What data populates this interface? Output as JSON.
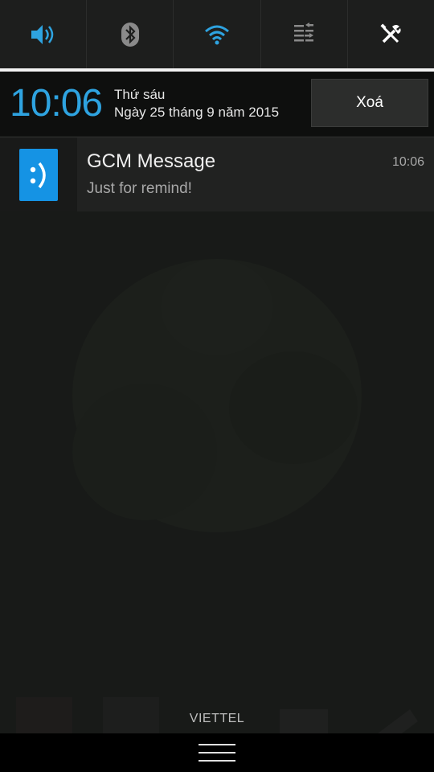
{
  "quick_settings": {
    "tiles": [
      {
        "icon": "volume-icon",
        "color": "#2ea3e0"
      },
      {
        "icon": "bluetooth-icon",
        "color": "#8a8a8a"
      },
      {
        "icon": "wifi-icon",
        "color": "#2ea3e0"
      },
      {
        "icon": "data-sync-icon",
        "color": "#8a8a8a"
      },
      {
        "icon": "settings-tools-icon",
        "color": "#ffffff"
      }
    ]
  },
  "header": {
    "clock": "10:06",
    "weekday": "Thứ sáu",
    "date": "Ngày 25 tháng 9 năm 2015",
    "clear_label": "Xoá"
  },
  "notifications": [
    {
      "icon": "smiley-app-icon",
      "icon_text": ":)",
      "title": "GCM Message",
      "text": "Just for remind!",
      "time": "10:06"
    }
  ],
  "carrier": "VIETTEL",
  "colors": {
    "accent": "#2ea3e0",
    "notif_icon_bg": "#1593e4"
  }
}
